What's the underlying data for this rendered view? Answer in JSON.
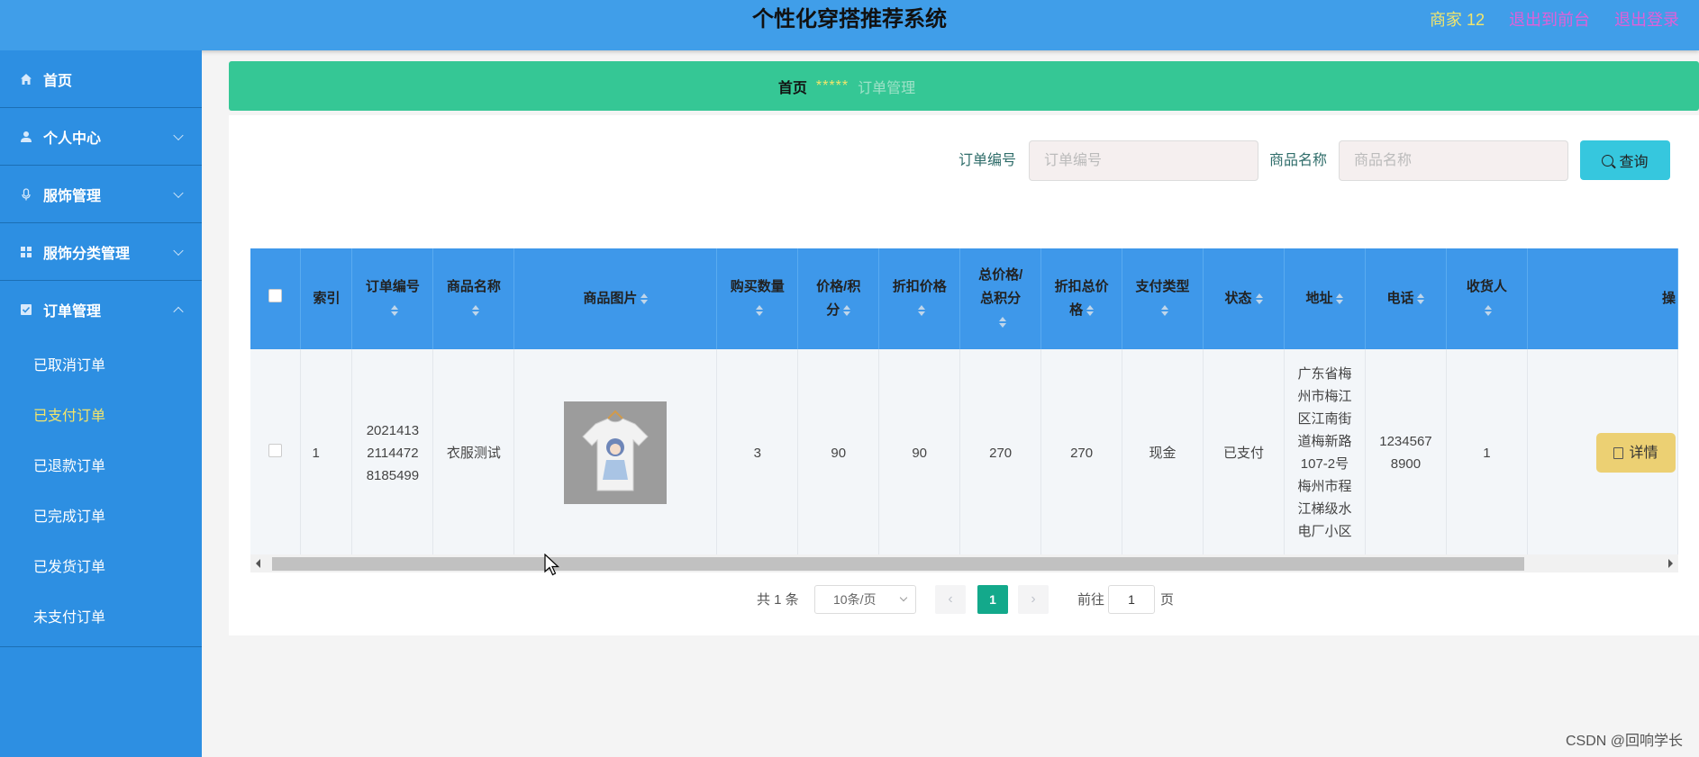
{
  "header": {
    "title": "个性化穿搭推荐系统",
    "merchant": "商家 12",
    "back_to_front": "退出到前台",
    "logout": "退出登录"
  },
  "sidebar": {
    "items": [
      {
        "label": "首页",
        "icon": "home-icon"
      },
      {
        "label": "个人中心",
        "icon": "user-icon"
      },
      {
        "label": "服饰管理",
        "icon": "mic-icon"
      },
      {
        "label": "服饰分类管理",
        "icon": "grid-icon"
      },
      {
        "label": "订单管理",
        "icon": "checkbox-icon"
      }
    ],
    "sub_items": [
      "已取消订单",
      "已支付订单",
      "已退款订单",
      "已完成订单",
      "已发货订单",
      "未支付订单"
    ],
    "active_sub": "已支付订单"
  },
  "breadcrumb": {
    "home": "首页",
    "separator": "*****",
    "current": "订单管理"
  },
  "search": {
    "order_no_label": "订单编号",
    "order_no_placeholder": "订单编号",
    "product_label": "商品名称",
    "product_placeholder": "商品名称",
    "query_button": "查询"
  },
  "table": {
    "headers": {
      "index": "索引",
      "order_no": "订单编号",
      "product_name": "商品名称",
      "product_image": "商品图片",
      "quantity": "购买数量",
      "price_l1": "价格/积",
      "price_l2": "分",
      "discount_price": "折扣价格",
      "total_l1": "总价格/",
      "total_l2": "总积分",
      "discount_total_l1": "折扣总价",
      "discount_total_l2": "格",
      "pay_type": "支付类型",
      "status": "状态",
      "address": "地址",
      "phone": "电话",
      "receiver_l1": "收货人",
      "actions": "操"
    },
    "rows": [
      {
        "index": "1",
        "order_no": "20214132114472818 5499",
        "order_no_lines": [
          "2021413",
          "2114472",
          "8185499"
        ],
        "product_name": "衣服测试",
        "quantity": "3",
        "price": "90",
        "discount_price": "90",
        "total": "270",
        "discount_total": "270",
        "pay_type": "现金",
        "status": "已支付",
        "address_lines": [
          "广东省梅",
          "州市梅江",
          "区江南街",
          "道梅新路",
          "107-2号",
          "梅州市程",
          "江梯级水",
          "电厂小区"
        ],
        "phone_lines": [
          "1234567",
          "8900"
        ],
        "receiver": "1",
        "detail_button": "详情"
      }
    ]
  },
  "pagination": {
    "total": "共 1 条",
    "page_size": "10条/页",
    "current_page": "1",
    "goto_label": "前往",
    "goto_value": "1",
    "goto_suffix": "页"
  },
  "watermark": "CSDN @回响学长",
  "colors": {
    "header": "#409ee9",
    "sidebar": "#2d8fe2",
    "breadcrumb": "#35c795",
    "table_header": "#3e98ea",
    "query_button": "#36c7de",
    "detail_button": "#ecd073",
    "active_page": "#13a98b"
  }
}
